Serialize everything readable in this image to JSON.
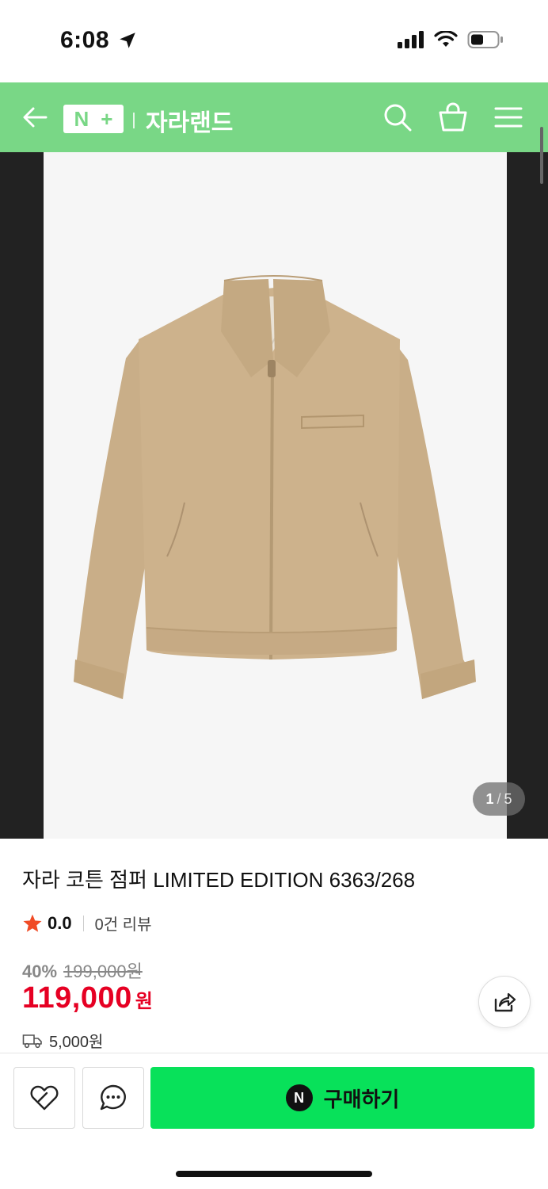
{
  "status_bar": {
    "time": "6:08"
  },
  "header": {
    "logo_left": "N",
    "logo_right": "+",
    "store_name": "자라랜드"
  },
  "gallery": {
    "current": "1",
    "total": "5"
  },
  "product": {
    "title": "자라 코튼 점퍼 LIMITED EDITION 6363/268",
    "rating": "0.0",
    "review_count": "0건 리뷰",
    "discount_rate": "40%",
    "original_price": "199,000원",
    "sale_price": "119,000",
    "price_unit": "원",
    "delivery_fee": "5,000원"
  },
  "bottom_bar": {
    "buy_label": "구매하기",
    "npay_badge": "N"
  },
  "colors": {
    "header_green": "#79d786",
    "buy_green": "#08e15a",
    "price_red": "#e60023",
    "star": "#f04b25"
  },
  "icons": [
    "location-arrow-icon",
    "signal-icon",
    "wifi-icon",
    "battery-icon",
    "back-arrow-icon",
    "search-icon",
    "cart-icon",
    "menu-icon",
    "star-icon",
    "truck-icon",
    "share-icon",
    "wishlist-icon",
    "chat-icon"
  ]
}
